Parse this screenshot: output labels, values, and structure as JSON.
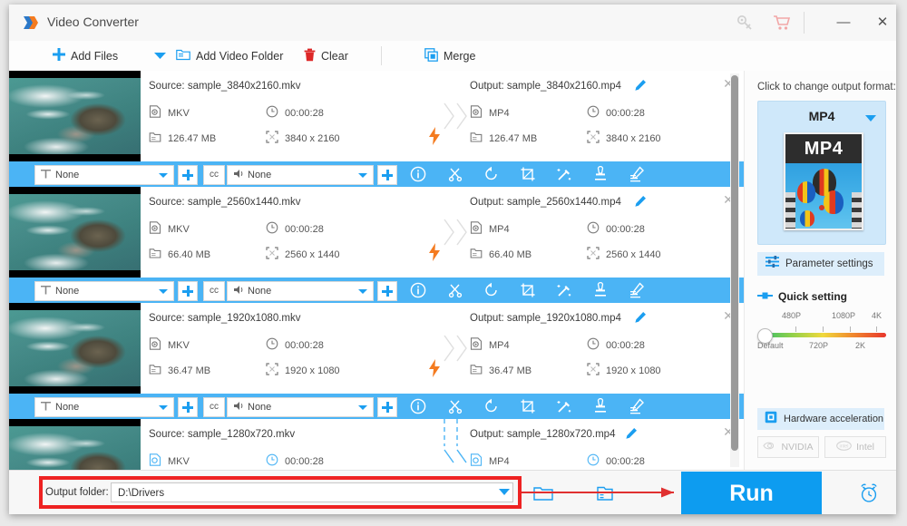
{
  "window": {
    "title": "Video Converter",
    "logo_icon": "app-logo-icon",
    "license_icon": "key-icon",
    "cart_icon": "cart-icon",
    "minimize_label": "—",
    "close_label": "✕"
  },
  "toolbar": {
    "add_files": "Add Files",
    "add_files_icon": "plus-icon",
    "add_files_dropdown_icon": "chevron-down-icon",
    "add_video_folder": "Add Video Folder",
    "add_video_folder_icon": "folder-add-icon",
    "clear": "Clear",
    "clear_icon": "trash-icon",
    "merge": "Merge",
    "merge_icon": "merge-squares-icon"
  },
  "list": {
    "source_prefix": "Source: ",
    "output_prefix": "Output: ",
    "rows": [
      {
        "thumbnail": "ocean-coastline-thumbnail",
        "source": {
          "filename": "sample_3840x2160.mkv",
          "format": "MKV",
          "duration": "00:00:28",
          "size": "126.47 MB",
          "resolution": "3840 x 2160"
        },
        "output": {
          "filename": "sample_3840x2160.mp4",
          "format": "MP4",
          "duration": "00:00:28",
          "size": "126.47 MB",
          "resolution": "3840 x 2160"
        }
      },
      {
        "thumbnail": "ocean-coastline-thumbnail",
        "source": {
          "filename": "sample_2560x1440.mkv",
          "format": "MKV",
          "duration": "00:00:28",
          "size": "66.40 MB",
          "resolution": "2560 x 1440"
        },
        "output": {
          "filename": "sample_2560x1440.mp4",
          "format": "MP4",
          "duration": "00:00:28",
          "size": "66.40 MB",
          "resolution": "2560 x 1440"
        }
      },
      {
        "thumbnail": "ocean-coastline-thumbnail",
        "source": {
          "filename": "sample_1920x1080.mkv",
          "format": "MKV",
          "duration": "00:00:28",
          "size": "36.47 MB",
          "resolution": "1920 x 1080"
        },
        "output": {
          "filename": "sample_1920x1080.mp4",
          "format": "MP4",
          "duration": "00:00:28",
          "size": "36.47 MB",
          "resolution": "1920 x 1080"
        }
      },
      {
        "thumbnail": "ocean-coastline-thumbnail",
        "source": {
          "filename": "sample_1280x720.mkv",
          "format": "MKV",
          "duration": "00:00:28",
          "size": "",
          "resolution": ""
        },
        "output": {
          "filename": "sample_1280x720.mp4",
          "format": "MP4",
          "duration": "00:00:28",
          "size": "",
          "resolution": ""
        }
      }
    ],
    "edit_strip": {
      "subtitle_value": "None",
      "subtitle_icon": "subtitle-t-icon",
      "audio_value": "None",
      "audio_icon": "speaker-icon",
      "add_subtitle_icon": "plus-icon",
      "add_audio_icon": "plus-icon",
      "cc_label": "cc",
      "tools": [
        "info-icon",
        "scissors-cut-icon",
        "rotate-icon",
        "crop-icon",
        "effects-wand-icon",
        "watermark-stamp-icon",
        "edit-pencil-icon"
      ]
    },
    "convert_arrow_icon": "lightning-bolt-icon",
    "remove_icon": "close-icon",
    "rename_icon": "pencil-icon",
    "format_icon": "file-video-icon",
    "clock_icon": "clock-icon",
    "size_icon": "file-size-icon",
    "resolution_icon": "resize-icon"
  },
  "sidebar": {
    "change_format_label": "Click to change output format:",
    "format_name": "MP4",
    "format_dropdown_icon": "chevron-down-icon",
    "format_thumb_label": "MP4",
    "parameter_settings": "Parameter settings",
    "parameter_settings_icon": "sliders-icon",
    "quick_setting": "Quick setting",
    "quick_setting_icon": "slider-small-icon",
    "slider_labels_top": [
      "480P",
      "1080P",
      "4K"
    ],
    "slider_labels_bottom": [
      "Default",
      "720P",
      "2K"
    ],
    "hardware_acceleration": "Hardware acceleration",
    "hardware_acceleration_icon": "chip-icon",
    "nvidia_label": "NVIDIA",
    "nvidia_icon": "nvidia-icon",
    "intel_label": "Intel",
    "intel_icon": "intel-icon"
  },
  "bottom": {
    "output_folder_label": "Output folder:",
    "output_folder_value": "D:\\Drivers",
    "output_folder_dropdown_icon": "chevron-down-icon",
    "open_folder_icon": "folder-open-icon",
    "browse_folder_icon": "folder-browse-icon",
    "run_label": "Run",
    "schedule_icon": "alarm-clock-icon"
  },
  "colors": {
    "accent_blue": "#0d9cf0",
    "strip_blue": "#4bb4f5",
    "highlight_red": "#ee2222",
    "bolt_orange": "#f47b20",
    "card_blue": "#cfe8fa"
  }
}
